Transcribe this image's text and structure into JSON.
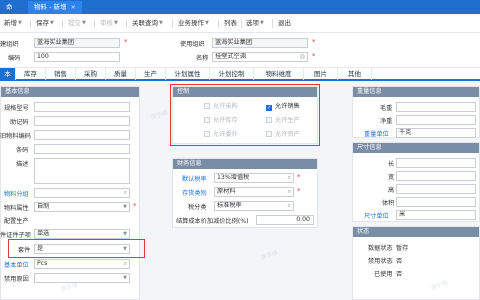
{
  "tabbar": {
    "home": "命",
    "active_tab": "物料 - 新增"
  },
  "toolbar": {
    "new": "新增",
    "save": "保存",
    "submit": "提交",
    "audit": "审核",
    "related": "关联查询",
    "ops": "业务操作",
    "list": "列表",
    "options": "选项",
    "exit": "退出"
  },
  "header": {
    "create_org_label": "建组织",
    "create_org_value": "蓝海实业集团",
    "use_org_label": "使用组织",
    "use_org_value": "蓝海实业集团",
    "code_label": "编码",
    "code_value": "100",
    "name_label": "名称",
    "name_value": "挂壁式空调"
  },
  "tabs": [
    "本",
    "库存",
    "销售",
    "采购",
    "质量",
    "生产",
    "计划属性",
    "计划控制",
    "物料维度",
    "图片",
    "其他"
  ],
  "basic": {
    "title": "基本信息",
    "spec_label": "规格型号",
    "mnemonic_label": "助记码",
    "old_code_label": "旧物料编码",
    "barcode_label": "条码",
    "desc_label": "描述",
    "group_label": "物料分组",
    "attr_label": "物料属性",
    "attr_value": "自制",
    "config_label": "配置生产",
    "subitem_label": "件证件子项",
    "subitem_value": "单选",
    "kit_label": "套件",
    "kit_value": "是",
    "unit_label": "基本单位",
    "unit_value": "Pcs",
    "disable_reason_label": "禁用原因"
  },
  "control": {
    "title": "控制",
    "allow_purchase": "允许采购",
    "allow_sales": "允许销售",
    "allow_stock": "允许库存",
    "allow_produce": "允许生产",
    "allow_outsource": "允许委外",
    "allow_asset": "允许资产"
  },
  "finance": {
    "title": "财务信息",
    "tax_rate_label": "默认税率",
    "tax_rate_value": "13%增值税",
    "stock_type_label": "存货类别",
    "stock_type_value": "原材料",
    "tax_class_label": "税分类",
    "tax_class_value": "标准税率",
    "cost_label": "结算成本价加减价比例(%)",
    "cost_value": "0.00"
  },
  "weight": {
    "title": "重量信息",
    "gross_label": "毛重",
    "net_label": "净重",
    "unit_label": "重量单位",
    "unit_value": "千克"
  },
  "size": {
    "title": "尺寸信息",
    "length_label": "长",
    "width_label": "宽",
    "height_label": "高",
    "volume_label": "体积",
    "unit_label": "尺寸单位",
    "unit_value": "米"
  },
  "status": {
    "title": "状态",
    "data_status_label": "数据状态",
    "data_status_value": "暂存",
    "disable_status_label": "禁用状态",
    "disable_status_value": "否",
    "used_label": "已使用",
    "used_value": "否"
  },
  "watermark": "演示版",
  "colors": {
    "accent": "#1f6fd1",
    "highlight_border": "#e4393c",
    "required": "#e23b3b"
  }
}
